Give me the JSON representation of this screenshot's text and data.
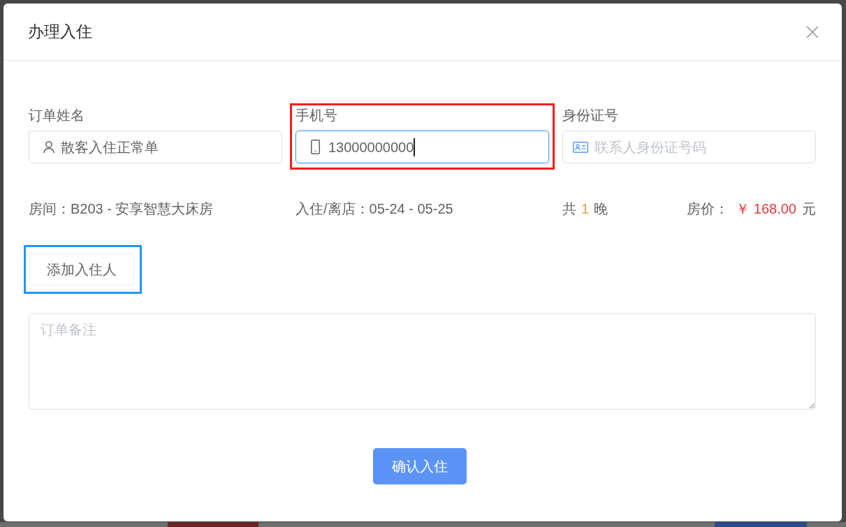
{
  "dialog": {
    "title": "办理入住"
  },
  "fields": [
    {
      "kind": "name",
      "label": "订单姓名",
      "value": "散客入住正常单",
      "focused": false
    },
    {
      "kind": "phone",
      "label": "手机号",
      "value": "13000000000",
      "focused": true,
      "highlight": {
        "color": "#f21c1c"
      }
    },
    {
      "kind": "id_card",
      "label": "身份证号",
      "placeholder": "联系人身份证号码",
      "focused": false
    }
  ],
  "stay": {
    "room": "房间：B203 - 安享智慧大床房",
    "dates": "入住/离店：05-24 - 05-25",
    "nights": {
      "before": "共",
      "count": "1",
      "after": "晚"
    },
    "price": {
      "label": "房价：",
      "amount": "￥ 168.00",
      "unit": "元"
    }
  },
  "add_guest_button": {
    "label": "添加入住人",
    "highlight": {
      "color": "#2196f3"
    }
  },
  "remarks": {
    "placeholder": "订单备注"
  },
  "confirm_button": {
    "label": "确认入住"
  },
  "background": {
    "blocks": [
      {
        "color": "#6b2424"
      },
      {
        "color": "#294a8c"
      }
    ]
  }
}
